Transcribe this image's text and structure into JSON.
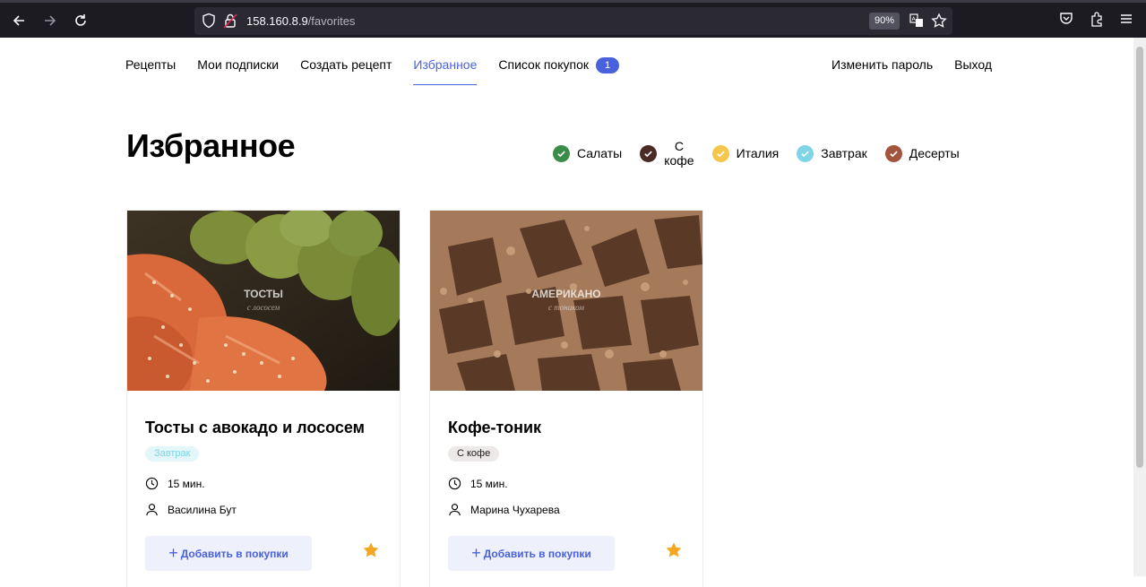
{
  "browser": {
    "url_host": "158.160.8.9",
    "url_path": "/favorites",
    "zoom": "90%"
  },
  "nav": {
    "items": [
      {
        "label": "Рецепты",
        "active": false
      },
      {
        "label": "Мои подписки",
        "active": false
      },
      {
        "label": "Создать рецепт",
        "active": false
      },
      {
        "label": "Избранное",
        "active": true
      },
      {
        "label": "Список покупок",
        "active": false
      }
    ],
    "cart_count": "1",
    "change_password": "Изменить пароль",
    "logout": "Выход"
  },
  "page": {
    "title": "Избранное"
  },
  "tags": [
    {
      "label": "Салаты",
      "color": "#3a8c48"
    },
    {
      "label_line1": "С",
      "label_line2": "кофе",
      "color": "#4a2a24"
    },
    {
      "label": "Италия",
      "color": "#f4c64b"
    },
    {
      "label": "Завтрак",
      "color": "#7fd4e8"
    },
    {
      "label": "Десерты",
      "color": "#a2553c"
    }
  ],
  "recipes": [
    {
      "image_caption_1": "ТОСТЫ",
      "image_caption_2": "с лососем",
      "name": "Тосты с авокадо и лососем",
      "tag": "Завтрак",
      "tag_bg": "#e3f6fa",
      "tag_color": "#7fd4e8",
      "time": "15 мин.",
      "author": "Василина Бут",
      "add_label": "Добавить в покупки",
      "favorite": true
    },
    {
      "image_caption_1": "АМЕРИКАНО",
      "image_caption_2": "с тоником",
      "name": "Кофе-тоник",
      "tag": "С кофе",
      "tag_bg": "#ece9e8",
      "tag_color": "#1a1a1a",
      "time": "15 мин.",
      "author": "Марина Чухарева",
      "add_label": "Добавить в покупки",
      "favorite": true
    }
  ],
  "colors": {
    "accent": "#4a61dd",
    "star": "#f5a623"
  }
}
